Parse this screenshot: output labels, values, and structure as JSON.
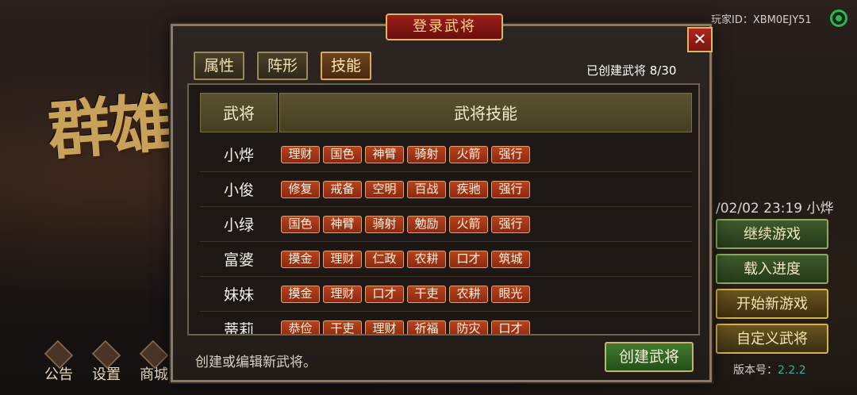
{
  "background": {
    "title_glyphs": "群雄",
    "player_id": "玩家ID：XBM0EJY51",
    "datetime": "/02/02 23:19 小烨",
    "menu": [
      "继续游戏",
      "载入进度",
      "开始新游戏",
      "自定义武将"
    ],
    "version_label": "版本号：",
    "version_number": "2.2.2",
    "bottom_icons": [
      "公告",
      "设置",
      "商城"
    ]
  },
  "dialog": {
    "title": "登录武将",
    "close": "✕",
    "tabs": [
      "属性",
      "阵形",
      "技能"
    ],
    "active_tab": "技能",
    "created_count": "已创建武将 8/30",
    "columns": [
      "武将",
      "武将技能"
    ],
    "rows": [
      {
        "name": "小烨",
        "skills": [
          "理财",
          "国色",
          "神臂",
          "骑射",
          "火箭",
          "强行"
        ]
      },
      {
        "name": "小俊",
        "skills": [
          "修复",
          "戒备",
          "空明",
          "百战",
          "疾驰",
          "强行"
        ]
      },
      {
        "name": "小绿",
        "skills": [
          "国色",
          "神臂",
          "骑射",
          "勉励",
          "火箭",
          "强行"
        ]
      },
      {
        "name": "富婆",
        "skills": [
          "摸金",
          "理财",
          "仁政",
          "农耕",
          "口才",
          "筑城"
        ]
      },
      {
        "name": "妹妹",
        "skills": [
          "摸金",
          "理财",
          "口才",
          "干吏",
          "农耕",
          "眼光"
        ]
      },
      {
        "name": "蒂莉",
        "skills": [
          "恭俭",
          "干吏",
          "理财",
          "祈福",
          "防灾",
          "口才"
        ]
      }
    ],
    "hint": "创建或编辑新武将。",
    "create_button": "创建武将"
  },
  "colors": {
    "skill_tag": "#b8421e",
    "title_bar": "#9c1e1a",
    "create_button": "#3f7a30",
    "signal": "#2fb35a"
  }
}
